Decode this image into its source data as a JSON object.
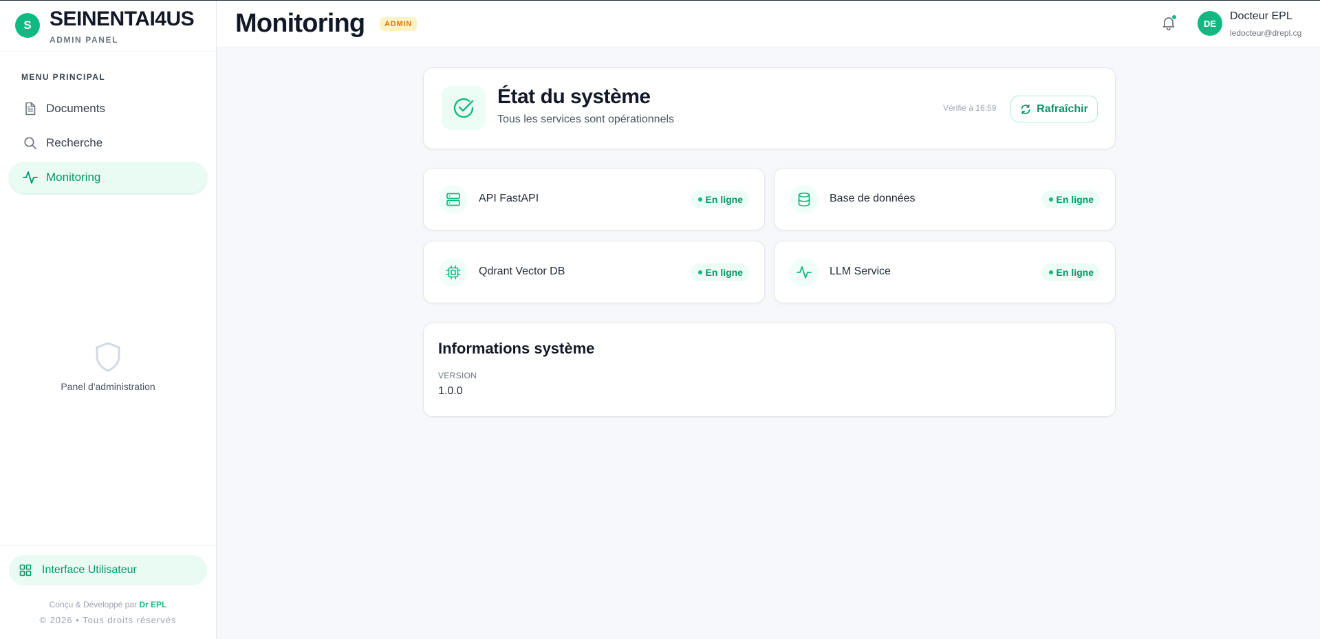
{
  "brand": {
    "logo_letter": "S",
    "name": "SEINENTAI4US",
    "subtitle": "ADMIN PANEL"
  },
  "sidebar": {
    "menu_heading": "MENU PRINCIPAL",
    "items": [
      {
        "label": "Documents",
        "icon": "document-icon",
        "active": false
      },
      {
        "label": "Recherche",
        "icon": "search-icon",
        "active": false
      },
      {
        "label": "Monitoring",
        "icon": "activity-icon",
        "active": true
      }
    ],
    "admin_panel_label": "Panel d'administration",
    "user_interface_label": "Interface Utilisateur",
    "credit_prefix": "Conçu & Développé par",
    "credit_author": "Dr EPL",
    "copyright": "© 2026 • Tous droits réservés"
  },
  "header": {
    "title": "Monitoring",
    "badge": "ADMIN",
    "user": {
      "initials": "DE",
      "name": "Docteur EPL",
      "email": "ledocteur@drepl.cg"
    }
  },
  "system_status": {
    "title": "État du système",
    "subtitle": "Tous les services sont opérationnels",
    "checked_at": "Vérifié à 16:59",
    "refresh_label": "Rafraîchir"
  },
  "services": [
    {
      "name": "API FastAPI",
      "status": "En ligne",
      "icon": "server-icon"
    },
    {
      "name": "Base de données",
      "status": "En ligne",
      "icon": "database-icon"
    },
    {
      "name": "Qdrant Vector DB",
      "status": "En ligne",
      "icon": "cpu-icon"
    },
    {
      "name": "LLM Service",
      "status": "En ligne",
      "icon": "activity-icon"
    }
  ],
  "system_info": {
    "title": "Informations système",
    "version_label": "VERSION",
    "version_value": "1.0.0"
  },
  "colors": {
    "accent": "#10b981",
    "accent_dark": "#059669",
    "badge_bg": "#fef3c7",
    "badge_text": "#d97706",
    "page_bg": "#f6f8fb"
  }
}
